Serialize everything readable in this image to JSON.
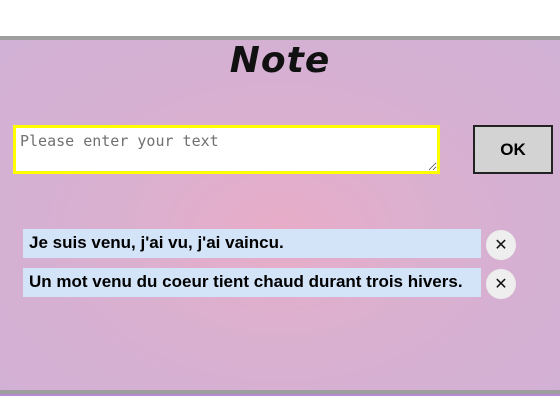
{
  "header": {
    "title": "Note"
  },
  "input": {
    "placeholder": "Please enter your text",
    "value": ""
  },
  "ok_button": {
    "label": "OK"
  },
  "notes": [
    {
      "text": "Je suis venu, j'ai vu, j'ai vaincu.",
      "delete_label": "✕",
      "delete_icon": "close-icon"
    },
    {
      "text": "Un mot venu du coeur tient chaud durant trois hivers.",
      "delete_label": "✕",
      "delete_icon": "close-icon"
    }
  ],
  "colors": {
    "background_center": "#e8acc8",
    "background_edge": "#d2b1d6",
    "input_border": "#ffff00",
    "button_bg": "#d3d3d3",
    "note_bg": "#d4e4f8",
    "delete_bg": "#eeeeee",
    "frame_border": "#9e9e9e"
  }
}
